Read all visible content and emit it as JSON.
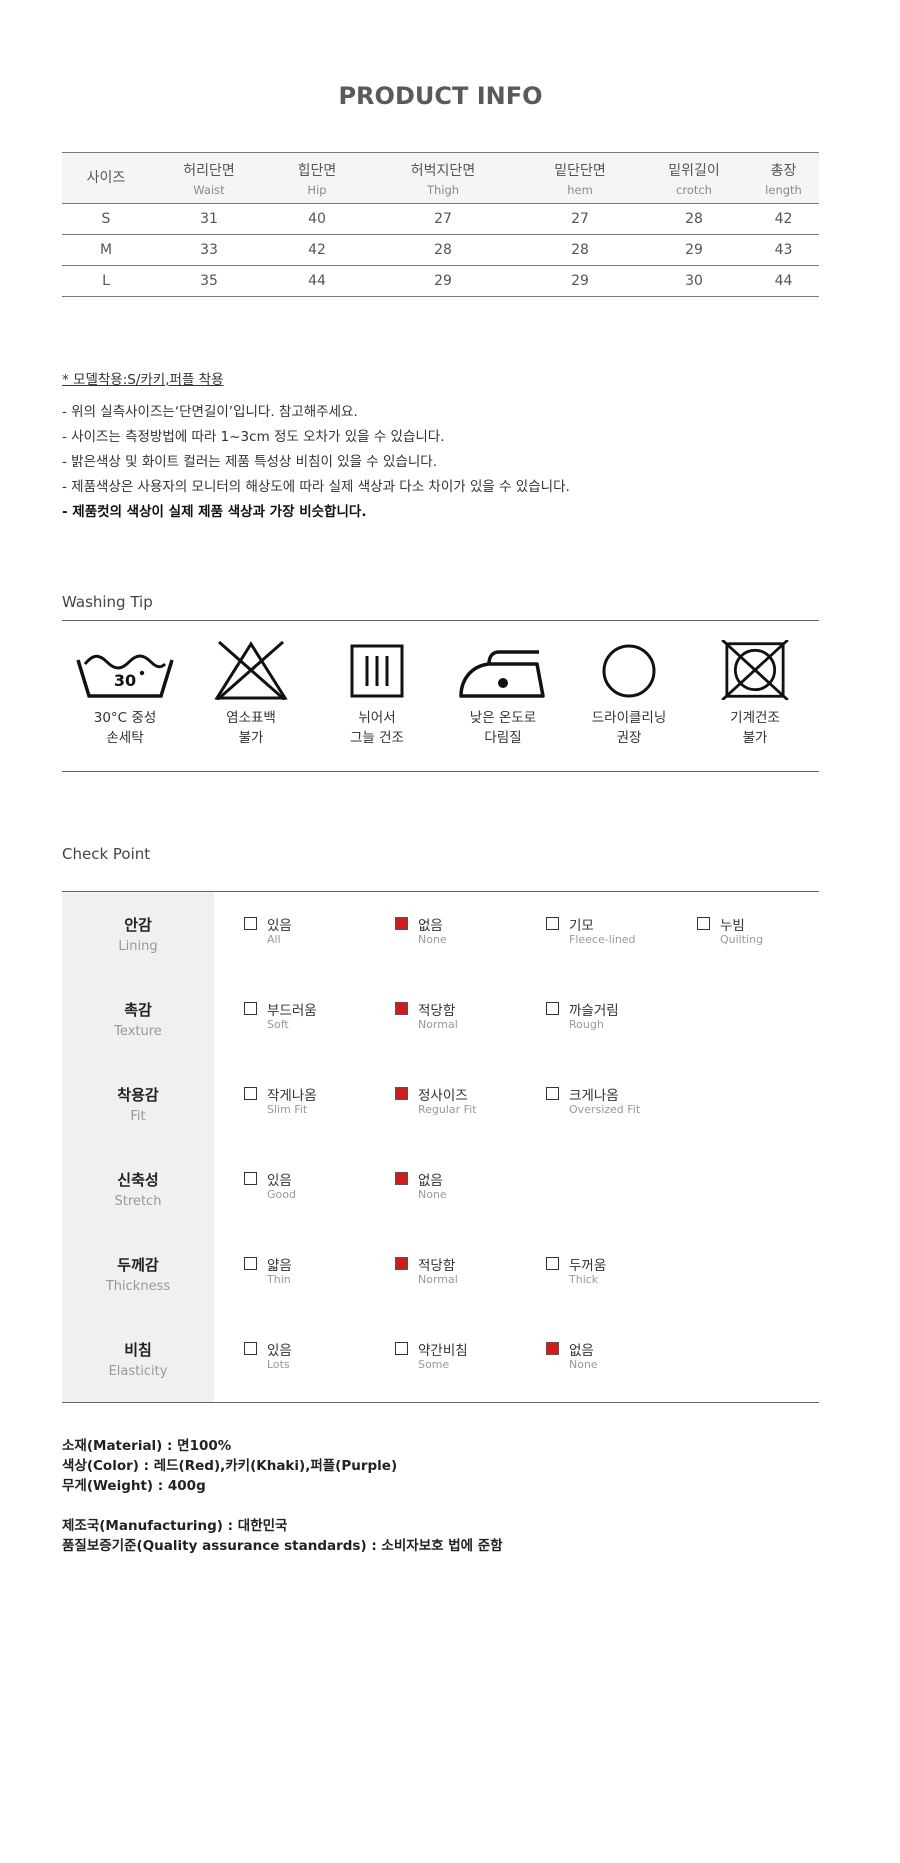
{
  "title": "PRODUCT INFO",
  "size_table": {
    "headers": [
      {
        "ko": "사이즈",
        "en": ""
      },
      {
        "ko": "허리단면",
        "en": "Waist"
      },
      {
        "ko": "힙단면",
        "en": "Hip"
      },
      {
        "ko": "허벅지단면",
        "en": "Thigh"
      },
      {
        "ko": "밑단단면",
        "en": "hem"
      },
      {
        "ko": "밑위길이",
        "en": "crotch"
      },
      {
        "ko": "총장",
        "en": "length"
      }
    ],
    "rows": [
      [
        "S",
        "31",
        "40",
        "27",
        "27",
        "28",
        "42"
      ],
      [
        "M",
        "33",
        "42",
        "28",
        "28",
        "29",
        "43"
      ],
      [
        "L",
        "35",
        "44",
        "29",
        "29",
        "30",
        "44"
      ]
    ]
  },
  "notes": {
    "model": "* 모델착용:S/카키,퍼플 착용",
    "lines": [
      "- 위의 실측사이즈는‘단면길이’입니다. 참고해주세요.",
      "- 사이즈는 측정방법에 따라 1~3cm 정도 오차가 있을 수 있습니다.",
      "- 밝은색상 및 화이트 컬러는 제품 특성상 비침이 있을 수 있습니다.",
      "- 제품색상은 사용자의 모니터의 해상도에 따라 실제 색상과 다소 차이가 있을 수 있습니다."
    ],
    "bold_line": "- 제품컷의 색상이 실제 제품 색상과 가장 비슷합니다."
  },
  "washing": {
    "title": "Washing Tip",
    "temp_label": "30",
    "items": [
      {
        "icon": "wash-30-icon",
        "line1": "30°C 중성",
        "line2": "손세탁"
      },
      {
        "icon": "no-bleach-icon",
        "line1": "염소표백",
        "line2": "불가"
      },
      {
        "icon": "line-dry-shade-icon",
        "line1": "뉘어서",
        "line2": "그늘 건조"
      },
      {
        "icon": "iron-low-icon",
        "line1": "낮은 온도로",
        "line2": "다림질"
      },
      {
        "icon": "dry-clean-icon",
        "line1": "드라이클리닝",
        "line2": "권장"
      },
      {
        "icon": "no-tumble-dry-icon",
        "line1": "기계건조",
        "line2": "불가"
      }
    ]
  },
  "checkpoint": {
    "title": "Check Point",
    "check_color": "#d11c1c",
    "rows": [
      {
        "ko": "안감",
        "en": "Lining",
        "options": [
          {
            "ko": "있음",
            "en": "All",
            "checked": false
          },
          {
            "ko": "없음",
            "en": "None",
            "checked": true
          },
          {
            "ko": "기모",
            "en": "Fleece-lined",
            "checked": false
          },
          {
            "ko": "누빔",
            "en": "Quilting",
            "checked": false
          }
        ]
      },
      {
        "ko": "촉감",
        "en": "Texture",
        "options": [
          {
            "ko": "부드러움",
            "en": "Soft",
            "checked": false
          },
          {
            "ko": "적당함",
            "en": "Normal",
            "checked": true
          },
          {
            "ko": "까슬거림",
            "en": "Rough",
            "checked": false
          }
        ]
      },
      {
        "ko": "착용감",
        "en": "Fit",
        "options": [
          {
            "ko": "작게나옴",
            "en": "Slim Fit",
            "checked": false
          },
          {
            "ko": "정사이즈",
            "en": "Regular Fit",
            "checked": true
          },
          {
            "ko": "크게나옴",
            "en": "Oversized Fit",
            "checked": false
          }
        ]
      },
      {
        "ko": "신축성",
        "en": "Stretch",
        "options": [
          {
            "ko": "있음",
            "en": "Good",
            "checked": false
          },
          {
            "ko": "없음",
            "en": "None",
            "checked": true
          }
        ]
      },
      {
        "ko": "두께감",
        "en": "Thickness",
        "options": [
          {
            "ko": "얇음",
            "en": "Thin",
            "checked": false
          },
          {
            "ko": "적당함",
            "en": "Normal",
            "checked": true
          },
          {
            "ko": "두꺼움",
            "en": "Thick",
            "checked": false
          }
        ]
      },
      {
        "ko": "비침",
        "en": "Elasticity",
        "options": [
          {
            "ko": "있음",
            "en": "Lots",
            "checked": false
          },
          {
            "ko": "약간비침",
            "en": "Some",
            "checked": false
          },
          {
            "ko": "없음",
            "en": "None",
            "checked": true
          }
        ]
      }
    ]
  },
  "material": {
    "material": "소재(Material) : 면100%",
    "color": "색상(Color) : 레드(Red),카키(Khaki),퍼플(Purple)",
    "weight": "무게(Weight) : 400g",
    "manufacturing": "제조국(Manufacturing) : 대한민국",
    "quality": "품질보증기준(Quality assurance standards) : 소비자보호 법에 준함"
  }
}
